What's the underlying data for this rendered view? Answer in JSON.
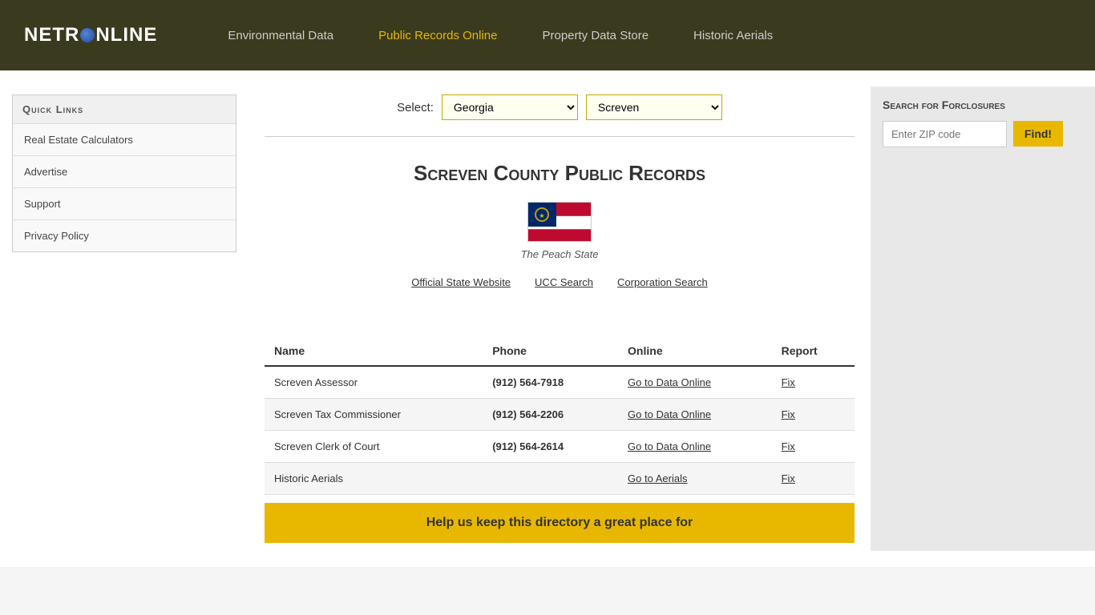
{
  "header": {
    "logo": "NETR○ONLINE",
    "nav": [
      {
        "label": "Environmental Data",
        "active": false
      },
      {
        "label": "Public Records Online",
        "active": true
      },
      {
        "label": "Property Data Store",
        "active": false
      },
      {
        "label": "Historic Aerials",
        "active": false
      }
    ]
  },
  "sidebar": {
    "heading": "Quick Links",
    "items": [
      {
        "label": "Real Estate Calculators"
      },
      {
        "label": "Advertise"
      },
      {
        "label": "Support"
      },
      {
        "label": "Privacy Policy"
      }
    ]
  },
  "select_row": {
    "label": "Select:",
    "state_value": "Georgia",
    "county_value": "Screven"
  },
  "county": {
    "title": "Screven County Public Records",
    "nickname": "The Peach State",
    "links": [
      {
        "label": "Official State Website"
      },
      {
        "label": "UCC Search"
      },
      {
        "label": "Corporation Search"
      }
    ]
  },
  "table": {
    "headers": [
      "Name",
      "Phone",
      "Online",
      "Report"
    ],
    "rows": [
      {
        "name": "Screven Assessor",
        "phone": "(912) 564-7918",
        "online_label": "Go to Data Online",
        "report_label": "Fix",
        "even": false
      },
      {
        "name": "Screven Tax Commissioner",
        "phone": "(912) 564-2206",
        "online_label": "Go to Data Online",
        "report_label": "Fix",
        "even": true
      },
      {
        "name": "Screven Clerk of Court",
        "phone": "(912) 564-2614",
        "online_label": "Go to Data Online",
        "report_label": "Fix",
        "even": false
      },
      {
        "name": "Historic Aerials",
        "phone": "",
        "online_label": "Go to Aerials",
        "report_label": "Fix",
        "even": true
      }
    ]
  },
  "right_panel": {
    "title": "Search for Forclosures",
    "zip_placeholder": "Enter ZIP code",
    "find_label": "Find!"
  },
  "bottom_banner": {
    "text": "Help us keep this directory a great place for"
  }
}
